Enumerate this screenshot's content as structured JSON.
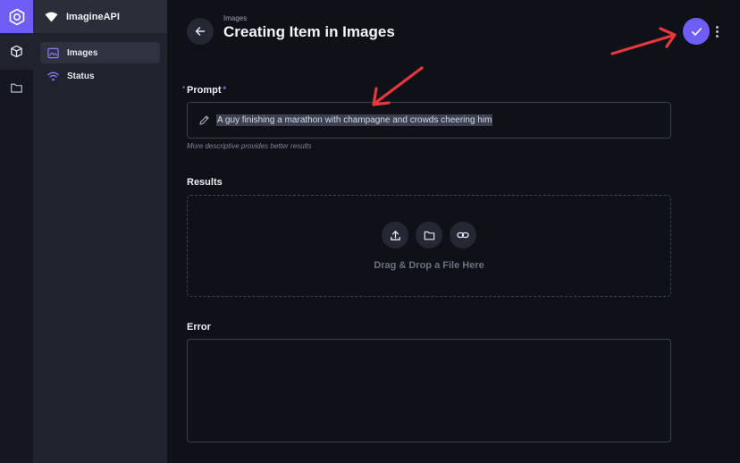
{
  "app": {
    "name": "ImagineAPI"
  },
  "sidebar": {
    "items": [
      {
        "label": "Images",
        "icon": "image-icon",
        "active": true
      },
      {
        "label": "Status",
        "icon": "wifi-icon",
        "active": false
      }
    ]
  },
  "header": {
    "breadcrumb": "Images",
    "title": "Creating Item in Images"
  },
  "form": {
    "prompt": {
      "required_marker": "*",
      "label": "Prompt",
      "required_star": "*",
      "value": "A guy finishing a marathon with champagne and crowds cheering him",
      "hint": "More descriptive provides better results"
    },
    "results": {
      "label": "Results",
      "drop_text": "Drag & Drop a File Here"
    },
    "error": {
      "label": "Error",
      "value": ""
    }
  },
  "colors": {
    "accent": "#6f5ef6",
    "annotation_arrow": "#e8383d"
  }
}
